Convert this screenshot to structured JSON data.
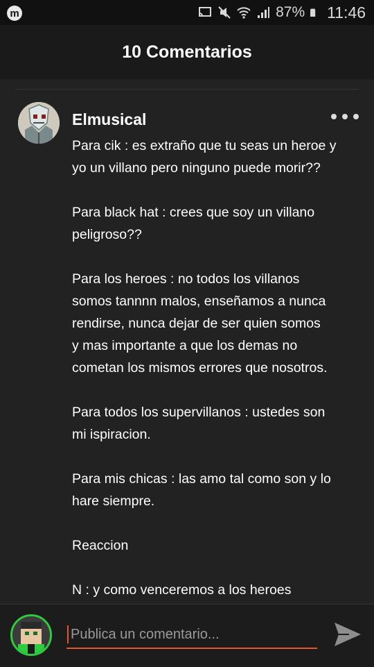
{
  "status_bar": {
    "app_icon_letter": "m",
    "icons": [
      "cast-icon",
      "mute-icon",
      "wifi-icon",
      "signal-icon",
      "battery-icon"
    ],
    "battery": "87%",
    "time": "11:46"
  },
  "header": {
    "title": "10 Comentarios"
  },
  "comment": {
    "author": "Elmusical",
    "paragraphs": [
      "Para cik : es extraño que tu seas un heroe y\nyo un villano pero ninguno puede morir??",
      "Para black hat : crees que soy un villano\npeligroso??",
      "Para los heroes : no todos los villanos\nsomos tannnn malos, enseñamos a nunca\nrendirse, nunca dejar de ser quien somos\ny mas importante a que los demas no\ncometan los mismos errores que nosotros.",
      "Para todos los supervillanos : ustedes son\nmi ispiracion.",
      "Para mis chicas : las amo tal como son y lo\nhare siempre.",
      "Reaccion",
      "N : y como venceremos a los heroes"
    ]
  },
  "composer": {
    "placeholder": "Publica un comentario..."
  },
  "colors": {
    "accent": "#e8542c",
    "avatar_ring": "#2ecc40",
    "background": "#222222"
  }
}
